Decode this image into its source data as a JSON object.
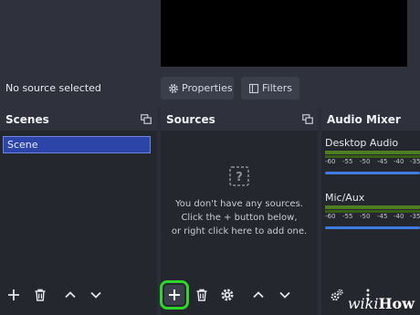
{
  "context": {
    "status": "No source selected",
    "properties_label": "Properties",
    "filters_label": "Filters"
  },
  "scenes": {
    "title": "Scenes",
    "items": [
      "Scene"
    ],
    "selected": "Scene"
  },
  "sources": {
    "title": "Sources",
    "empty_lines": [
      "You don't have any sources.",
      "Click the + button below,",
      "or right click here to add one."
    ]
  },
  "mixer": {
    "title": "Audio Mixer",
    "channels": [
      {
        "name": "Desktop Audio",
        "level_fraction": 1.0
      },
      {
        "name": "Mic/Aux",
        "level_fraction": 1.0
      }
    ],
    "ticks": [
      "-60",
      "-55",
      "-50",
      "-45",
      "-40",
      "-35"
    ]
  },
  "icons": {
    "properties": "gear-icon",
    "filters": "filters-icon",
    "undock": "undock-icon",
    "empty_sources": "question-mark-icon",
    "add": "plus-icon",
    "remove": "trash-icon",
    "move_up": "chevron-up-icon",
    "move_down": "chevron-down-icon",
    "source_properties": "gear-icon",
    "advanced_audio": "gears-icon",
    "more": "kebab-icon"
  },
  "colors": {
    "panel_bg": "#25272f",
    "header_bg": "#2f323c",
    "selection": "#2d44a8",
    "meter_green": "#4e7d22",
    "fader_blue": "#3f7be0",
    "highlight": "#2fd52a"
  },
  "watermark": {
    "part1": "wiki",
    "part2": "How"
  }
}
